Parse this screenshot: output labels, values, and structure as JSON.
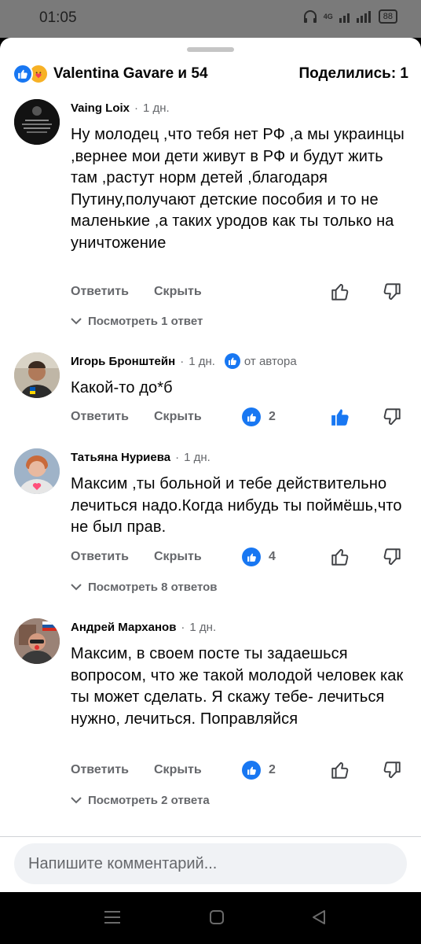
{
  "status": {
    "time": "01:05",
    "network": "4G",
    "battery": "88"
  },
  "header": {
    "reactors": "Valentina Gavare и 54",
    "shares": "Поделились: 1"
  },
  "actions": {
    "reply": "Ответить",
    "hide": "Скрыть"
  },
  "comments": [
    {
      "author": "Vaing Loix",
      "time": "1 дн.",
      "text": "Ну молодец ,что тебя нет РФ ,а мы украинцы ,вернее мои дети живут в РФ и будут жить там ,растут норм детей ,благодаря Путину,получают детские пособия и то не маленькие ,а таких уродов как ты только на уничтожение",
      "view_replies": "Посмотреть 1 ответ"
    },
    {
      "author": "Игорь Бронштейн",
      "time": "1 дн.",
      "badge": "от автора",
      "text": "Какой-то до*б",
      "likes": "2"
    },
    {
      "author": "Татьяна Нуриева",
      "time": "1 дн.",
      "text": "Максим ,ты больной и тебе действительно лечиться надо.Когда нибудь ты поймёшь,что не был прав.",
      "likes": "4",
      "view_replies": "Посмотреть 8 ответов"
    },
    {
      "author": "Андрей Марханов",
      "time": "1 дн.",
      "text": "Максим, в своем посте ты задаешься вопросом, что же такой молодой человек как ты может сделать. Я скажу тебе- лечиться нужно, лечиться. Поправляйся",
      "likes": "2",
      "view_replies": "Посмотреть 2 ответа"
    }
  ],
  "compose": {
    "placeholder": "Напишите комментарий..."
  },
  "colors": {
    "accent": "#1877f2",
    "text": "#050505",
    "secondary": "#65676b"
  }
}
